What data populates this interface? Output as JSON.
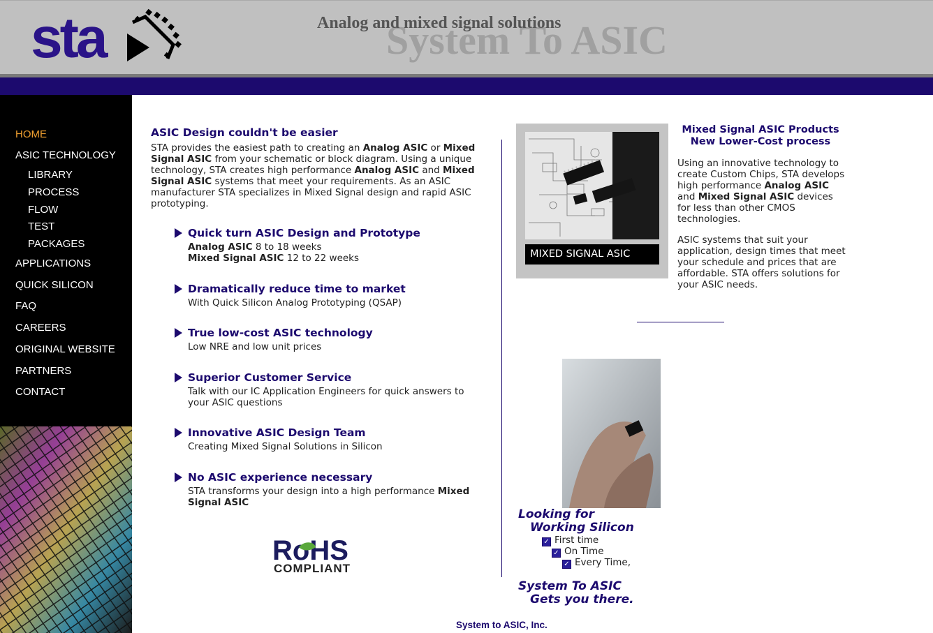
{
  "header": {
    "logo_text": "sta",
    "tagline_small": "Analog and mixed signal solutions",
    "tagline_big": "System To ASIC"
  },
  "nav": {
    "items": [
      {
        "label": "HOME",
        "active": true
      },
      {
        "label": "ASIC TECHNOLOGY"
      },
      {
        "label": "LIBRARY"
      },
      {
        "label": "PROCESS"
      },
      {
        "label": "FLOW"
      },
      {
        "label": "TEST"
      },
      {
        "label": "PACKAGES"
      },
      {
        "label": "APPLICATIONS"
      },
      {
        "label": "QUICK SILICON"
      },
      {
        "label": "FAQ"
      },
      {
        "label": "CAREERS"
      },
      {
        "label": "ORIGINAL WEBSITE"
      },
      {
        "label": "PARTNERS"
      },
      {
        "label": "CONTACT"
      }
    ]
  },
  "intro": {
    "title": "ASIC Design couldn't be easier",
    "t1": "STA provides the easiest path to creating an ",
    "b1": "Analog ASIC",
    "t2": " or ",
    "b2": "Mixed Signal ASIC",
    "t3": " from your schematic or block diagram. Using a unique technology, STA creates high performance ",
    "b3": "Analog ASIC",
    "t4": " and ",
    "b4": "Mixed Signal ASIC",
    "t5": " systems that meet your requirements. As an ASIC manufacturer STA specializes in Mixed Signal design and rapid ASIC prototyping."
  },
  "features": [
    {
      "title": "Quick turn ASIC Design and Prototype",
      "l1b": "Analog ASIC",
      "l1": " 8 to 18 weeks",
      "l2b": "Mixed Signal ASIC",
      "l2": " 12 to 22 weeks"
    },
    {
      "title": "Dramatically reduce time to market",
      "desc": "With Quick Silicon Analog Prototyping (QSAP)"
    },
    {
      "title": "True low-cost ASIC technology",
      "desc": "Low NRE and low unit prices"
    },
    {
      "title": "Superior Customer Service",
      "desc": "Talk with our IC Application Engineers for quick answers to your ASIC questions"
    },
    {
      "title": "Innovative ASIC Design Team",
      "desc": "Creating Mixed Signal Solutions in Silicon"
    },
    {
      "title": "No ASIC experience necessary",
      "desc": "STA transforms your design into a high performance ",
      "descb": "Mixed Signal ASIC"
    }
  ],
  "rohs": {
    "top": "RoHS",
    "bottom": "COMPLIANT"
  },
  "right": {
    "chip_caption": "MIXED SIGNAL ASIC",
    "prod_title_1": "Mixed Signal ASIC Products",
    "prod_title_2": "New Lower-Cost process",
    "p1_t1": "Using an innovative technology to create Custom Chips, STA develops high performance ",
    "p1_b1": "Analog ASIC",
    "p1_t2": " and ",
    "p1_b2": "Mixed Signal ASIC",
    "p1_t3": " devices for less than other CMOS technologies.",
    "p2": "ASIC systems that suit your application, design times that meet your schedule and prices that are affordable. STA offers solutions for your ASIC needs.",
    "looking_1": "Looking for",
    "looking_2": "Working Silicon",
    "checks": [
      "First time",
      "On Time",
      "Every Time,"
    ],
    "slogan_1": "System To ASIC",
    "slogan_2": "Gets you there."
  },
  "footer": {
    "text": "System to ASIC, Inc."
  },
  "colors": {
    "brand": "#1c0a6e",
    "nav_active": "#f0a030",
    "header_bg": "#c0c0c0"
  }
}
